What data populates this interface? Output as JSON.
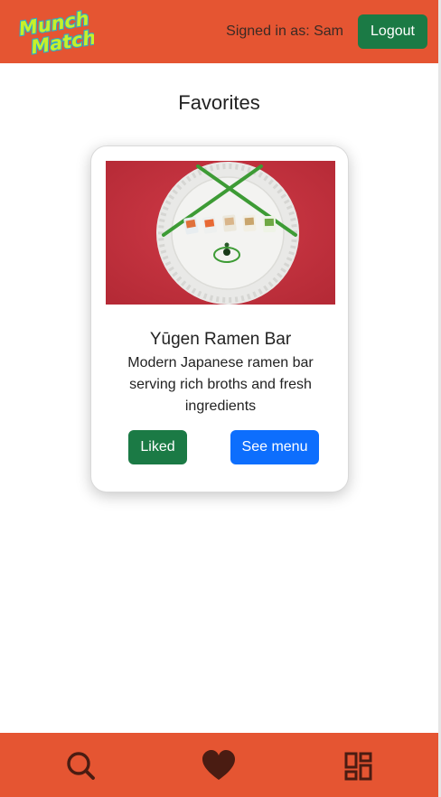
{
  "header": {
    "logo_text_line1": "Munch",
    "logo_text_line2": "Match",
    "signed_in_label": "Signed in as: Sam",
    "logout_label": "Logout"
  },
  "main": {
    "title": "Favorites",
    "cards": [
      {
        "name": "Yūgen Ramen Bar",
        "description": "Modern Japanese ramen bar serving rich broths and fresh ingredients",
        "liked_label": "Liked",
        "menu_label": "See menu"
      }
    ]
  },
  "bottom_nav": {
    "items": [
      {
        "icon": "search-icon"
      },
      {
        "icon": "heart-icon"
      },
      {
        "icon": "dashboard-icon"
      }
    ]
  },
  "colors": {
    "brand": "#e55532",
    "success": "#1b7a45",
    "primary": "#0d6efd",
    "logo_fill": "#c6f02a",
    "logo_outline": "#2ea8c9",
    "icon": "#4a1c12"
  }
}
